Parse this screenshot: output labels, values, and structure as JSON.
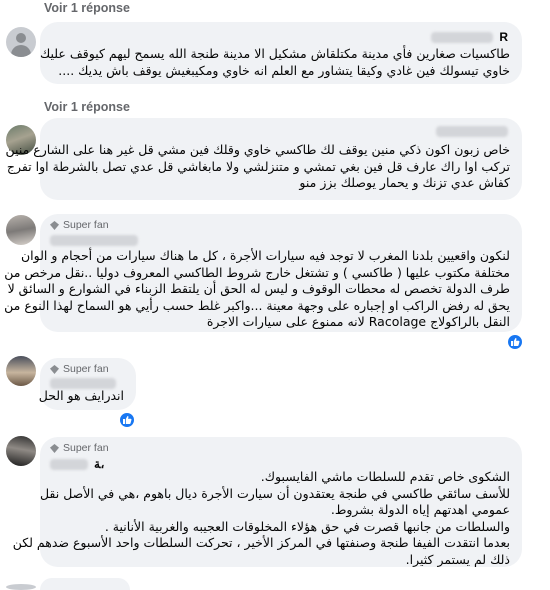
{
  "reply_links": [
    "Voir 1 réponse",
    "Voir 1 réponse"
  ],
  "comments": [
    {
      "name": "R",
      "badge": "",
      "lines": [
        "طاكسيات صغارين فأي مدينة مكتلقاش مشكيل الا مدينة طنجة الله يسمح ليهم كيوقف عليك",
        "خاوي تيسولك فين غادي وكيقا يتشاور مع العلم انه خاوي ومكيبغيش يوقف باش يديك ...."
      ]
    },
    {
      "name": "",
      "badge": "",
      "lines": [
        "خاص زبون اكون ذكي منين يوقف لك طاكسي خاوي وقلك فين مشي قل غير هنا على الشارع منين",
        "تركب اوا راك عارف قل فين بغي تمشي و متنزلشي ولا مابغاشي قل عدي تصل بالشرطة اوا تفرج",
        "كفاش عدي تزنك و يحمار يوصلك بزز منو"
      ]
    },
    {
      "name": "",
      "badge": "Super fan",
      "lines": [
        "لنكون واقعيين بلدنا المغرب لا توجد فيه سيارات الأجرة ، كل ما هناك سيارات من أحجام و الوان",
        "مختلفة مكتوب عليها ( طاكسي ) و تشتغل خارج شروط الطاكسي المعروف دوليا ..نقل مرخص من",
        "طرف الدولة تخصص له محطات الوقوف و ليس له الحق أن يلتقط الزبناء في الشوارع و السائق لا",
        "يحق له رفض الراكب او إجباره على وجهة معينة ...واكبر غلط حسب رأيي هو السماح لهذا النوع من",
        "النقل بالراكولاج Racolage لانه ممنوع على سيارات الاجرة"
      ]
    },
    {
      "name": "",
      "badge": "Super fan",
      "lines": [
        "اندرايف هو الحل"
      ]
    },
    {
      "name": "ﺔ،",
      "badge": "Super fan",
      "lines": [
        "الشكوى خاص تقدم للسلطات ماشي الفايسبوك.",
        "للأسف سائقي طاكسي في طنجة يعتقدون أن سيارت الأجرة ديال باهوم ،هي في الأصل نقل",
        "عمومي اهدتهم إياه الدولة بشروط.",
        "والسلطات من جانبها قصرت في حق هؤلاء المخلوقات العجيبه والغربية الأنانية .",
        "بعدما انتقدت الفيفا طنجة وصنفتها في المركز الأخير ، تحركت السلطات واحد الأسبوع ضدهم لكن",
        "ذلك لم يستمر كثيرا."
      ]
    }
  ],
  "colors": {
    "bubble": "#f0f2f5",
    "meta": "#65676b",
    "like": "#1877f2"
  },
  "icons": {
    "avatar_default": "person-silhouette-icon",
    "badge": "diamond-icon",
    "reaction": "thumbs-up-icon"
  }
}
